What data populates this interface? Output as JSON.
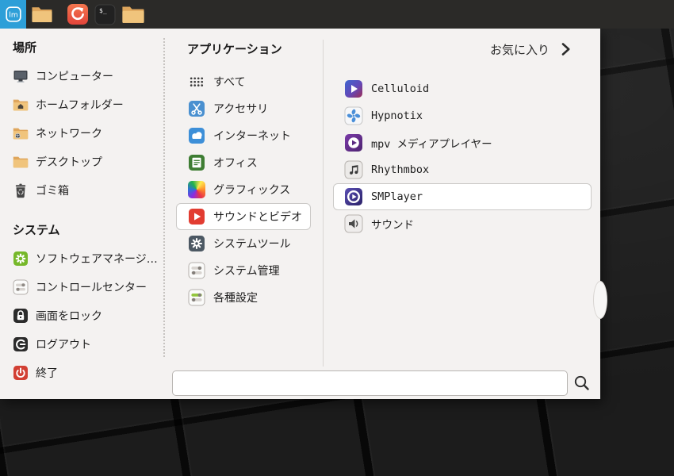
{
  "taskbar": {
    "items": [
      {
        "icon": "mint-menu-icon",
        "active": true
      },
      {
        "icon": "folder-icon"
      },
      {
        "icon": "firefox-icon"
      },
      {
        "icon": "terminal-icon"
      },
      {
        "icon": "files-icon"
      }
    ],
    "terminal_glyph": "$_"
  },
  "menu": {
    "places": {
      "header": "場所",
      "items": [
        {
          "label": "コンピューター",
          "icon": "computer-icon"
        },
        {
          "label": "ホームフォルダー",
          "icon": "home-folder-icon"
        },
        {
          "label": "ネットワーク",
          "icon": "network-folder-icon"
        },
        {
          "label": "デスクトップ",
          "icon": "desktop-folder-icon"
        },
        {
          "label": "ゴミ箱",
          "icon": "trash-icon"
        }
      ]
    },
    "system": {
      "header": "システム",
      "items": [
        {
          "label": "ソフトウェアマネージ…",
          "icon": "software-manager-icon"
        },
        {
          "label": "コントロールセンター",
          "icon": "control-center-icon"
        },
        {
          "label": "画面をロック",
          "icon": "lock-screen-icon"
        },
        {
          "label": "ログアウト",
          "icon": "logout-icon"
        },
        {
          "label": "終了",
          "icon": "shutdown-icon"
        }
      ]
    },
    "applications": {
      "header": "アプリケーション",
      "favorites_label": "お気に入り",
      "categories": [
        {
          "label": "すべて",
          "icon": "all-apps-icon",
          "selected": false
        },
        {
          "label": "アクセサリ",
          "icon": "accessories-icon",
          "selected": false
        },
        {
          "label": "インターネット",
          "icon": "internet-icon",
          "selected": false
        },
        {
          "label": "オフィス",
          "icon": "office-icon",
          "selected": false
        },
        {
          "label": "グラフィックス",
          "icon": "graphics-icon",
          "selected": false
        },
        {
          "label": "サウンドとビデオ",
          "icon": "sound-video-icon",
          "selected": true
        },
        {
          "label": "システムツール",
          "icon": "system-tools-icon",
          "selected": false
        },
        {
          "label": "システム管理",
          "icon": "system-admin-icon",
          "selected": false
        },
        {
          "label": "各種設定",
          "icon": "preferences-icon",
          "selected": false
        }
      ],
      "apps": [
        {
          "label": "Celluloid",
          "icon": "celluloid-icon",
          "selected": false
        },
        {
          "label": "Hypnotix",
          "icon": "hypnotix-icon",
          "selected": false
        },
        {
          "label": "mpv メディアプレイヤー",
          "icon": "mpv-icon",
          "selected": false
        },
        {
          "label": "Rhythmbox",
          "icon": "rhythmbox-icon",
          "selected": false
        },
        {
          "label": "SMPlayer",
          "icon": "smplayer-icon",
          "selected": true
        },
        {
          "label": "サウンド",
          "icon": "sound-settings-icon",
          "selected": false
        }
      ]
    },
    "search": {
      "value": "",
      "placeholder": ""
    }
  },
  "colors": {
    "mint_blue": "#2d9fd8",
    "taskbar_bg": "#2b2a28",
    "panel_bg": "#f4f2f1",
    "selection_bg": "#ffffff",
    "selection_border": "#cbc9c7"
  }
}
